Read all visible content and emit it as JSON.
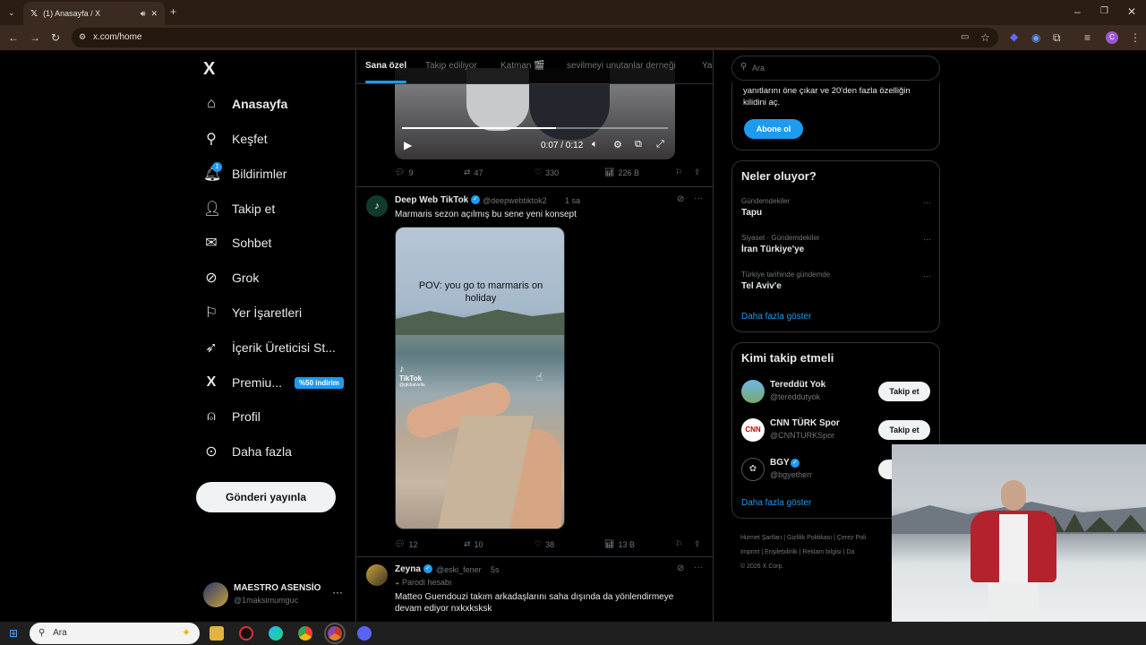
{
  "browser": {
    "tab_title": "(1) Anasayfa / X",
    "url": "x.com/home",
    "profile_initial": "C"
  },
  "nav": {
    "logo": "X",
    "items": [
      {
        "label": "Anasayfa",
        "icon": "home-icon"
      },
      {
        "label": "Keşfet",
        "icon": "search-icon"
      },
      {
        "label": "Bildirimler",
        "icon": "bell-icon",
        "badge": "1"
      },
      {
        "label": "Takip et",
        "icon": "person-add-icon"
      },
      {
        "label": "Sohbet",
        "icon": "mail-icon"
      },
      {
        "label": "Grok",
        "icon": "grok-icon"
      },
      {
        "label": "Yer İşaretleri",
        "icon": "bookmark-icon"
      },
      {
        "label": "İçerik Üreticisi St...",
        "icon": "rocket-icon"
      },
      {
        "label": "Premiu...",
        "icon": "x-premium-icon",
        "badge": "%50 indirim"
      },
      {
        "label": "Profil",
        "icon": "person-icon"
      },
      {
        "label": "Daha fazla",
        "icon": "more-circle-icon"
      }
    ],
    "post_button": "Gönderi yayınla",
    "account": {
      "name": "MAESTRO ASENSİO",
      "handle": "@1maksimumguc"
    }
  },
  "feed": {
    "tabs": [
      "Sana özel",
      "Takip ediliyor",
      "Katman 🎬",
      "sevilmeyi unutanlar derneği",
      "Ya"
    ],
    "video1": {
      "time": "0:07 / 0:12",
      "progress": 0.58
    },
    "post1_actions": {
      "replies": "9",
      "reposts": "47",
      "likes": "330",
      "views": "226 B"
    },
    "post2": {
      "author": "Deep Web TikTok",
      "handle": "@deepwebtiktok2",
      "time": "1 sa",
      "text": "Marmaris sezon açılmış bu sene yeni konsept",
      "video_caption": "POV: you go to marmaris on holiday",
      "watermark": "TikTok",
      "watermark_user": "@globalvella",
      "replies": "12",
      "reposts": "10",
      "likes": "38",
      "views": "13 B"
    },
    "post3": {
      "author": "Zeyna",
      "handle": "@eski_fener",
      "time": "5s",
      "label": "Parodi hesabı",
      "text": "Matteo Guendouzi takım arkadaşlarını saha dışında da yönlendirmeye devam ediyor nxkxksksk"
    }
  },
  "sidebar": {
    "search_placeholder": "Ara",
    "premium_text": "yanıtlarını öne çıkar ve 20'den fazla özelliğin kilidini aç.",
    "subscribe_button": "Abone ol",
    "trends_title": "Neler oluyor?",
    "trends": [
      {
        "category": "Gündemdekiler",
        "name": "Tapu"
      },
      {
        "category": "Siyaset · Gündemdekiler",
        "name": "İran Türkiye'ye"
      },
      {
        "category": "Türkiye tarihinde gündemde",
        "name": "Tel Aviv'e"
      }
    ],
    "show_more": "Daha fazla göster",
    "who_to_follow_title": "Kimi takip etmeli",
    "who_to_follow": [
      {
        "name": "Tereddüt Yok",
        "handle": "@tereddutyok",
        "button": "Takip et"
      },
      {
        "name": "CNN TÜRK Spor",
        "handle": "@CNNTURKSpor",
        "button": "Takip et"
      },
      {
        "name": "BGY",
        "handle": "@bgyetherr",
        "button": "T"
      }
    ],
    "footer_line1": [
      "Hizmet Şartları",
      "Gizlilik Politikası",
      "Çerez Poli"
    ],
    "footer_line2": [
      "Imprint",
      "Erişilebilirlik",
      "Reklam bilgisi",
      "Da"
    ],
    "copyright": "© 2026 X Corp."
  },
  "taskbar": {
    "search_placeholder": "Ara"
  },
  "colors": {
    "accent": "#1d9bf0",
    "background": "#000000",
    "border": "#2f3336",
    "chrome": "#3a2a1f"
  }
}
